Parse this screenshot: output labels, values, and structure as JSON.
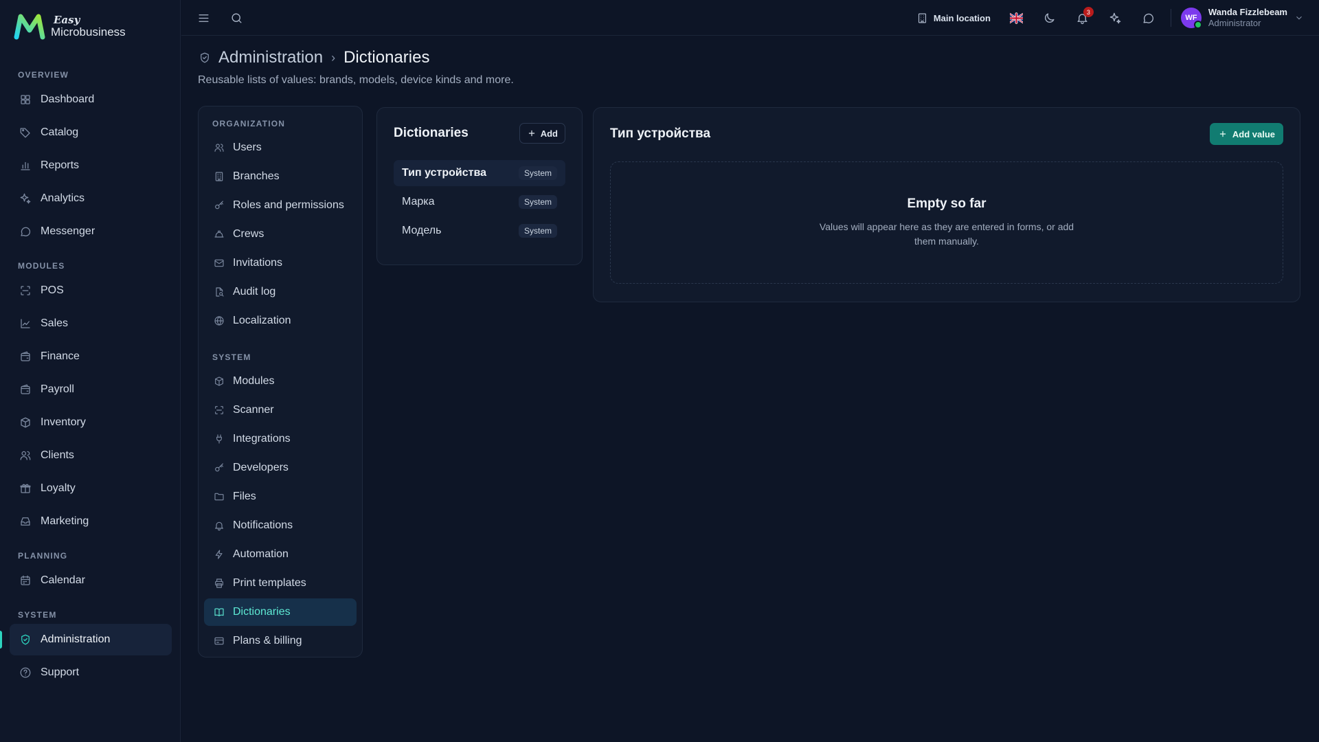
{
  "brand": {
    "easy": "Easy",
    "name": "Microbusiness"
  },
  "sidebar": {
    "sections": [
      {
        "title": "OVERVIEW",
        "items": [
          {
            "label": "Dashboard",
            "icon": "dashboard-icon"
          },
          {
            "label": "Catalog",
            "icon": "tag-icon"
          },
          {
            "label": "Reports",
            "icon": "bar-chart-icon"
          },
          {
            "label": "Analytics",
            "icon": "sparkles-icon"
          },
          {
            "label": "Messenger",
            "icon": "chat-icon"
          }
        ]
      },
      {
        "title": "MODULES",
        "items": [
          {
            "label": "POS",
            "icon": "scan-icon"
          },
          {
            "label": "Sales",
            "icon": "line-chart-icon"
          },
          {
            "label": "Finance",
            "icon": "wallet-icon"
          },
          {
            "label": "Payroll",
            "icon": "wallet-icon"
          },
          {
            "label": "Inventory",
            "icon": "box-icon"
          },
          {
            "label": "Clients",
            "icon": "users-icon"
          },
          {
            "label": "Loyalty",
            "icon": "gift-icon"
          },
          {
            "label": "Marketing",
            "icon": "inbox-icon"
          }
        ]
      },
      {
        "title": "PLANNING",
        "items": [
          {
            "label": "Calendar",
            "icon": "calendar-icon"
          }
        ]
      },
      {
        "title": "SYSTEM",
        "items": [
          {
            "label": "Administration",
            "icon": "shield-icon",
            "active": true
          },
          {
            "label": "Support",
            "icon": "help-icon"
          }
        ]
      }
    ]
  },
  "topbar": {
    "location": "Main location",
    "notifications_count": "3",
    "user": {
      "initials": "WF",
      "name": "Wanda Fizzlebeam",
      "role": "Administrator"
    }
  },
  "page": {
    "breadcrumb_parent": "Administration",
    "breadcrumb_sep": "›",
    "title": "Dictionaries",
    "description": "Reusable lists of values: brands, models, device kinds and more."
  },
  "submenu": {
    "sections": [
      {
        "title": "ORGANIZATION",
        "items": [
          {
            "label": "Users",
            "icon": "users-icon"
          },
          {
            "label": "Branches",
            "icon": "building-icon"
          },
          {
            "label": "Roles and permissions",
            "icon": "key-icon"
          },
          {
            "label": "Crews",
            "icon": "hard-hat-icon"
          },
          {
            "label": "Invitations",
            "icon": "mail-icon"
          },
          {
            "label": "Audit log",
            "icon": "file-search-icon"
          },
          {
            "label": "Localization",
            "icon": "globe-icon"
          }
        ]
      },
      {
        "title": "SYSTEM",
        "items": [
          {
            "label": "Modules",
            "icon": "box-icon"
          },
          {
            "label": "Scanner",
            "icon": "scan-icon"
          },
          {
            "label": "Integrations",
            "icon": "plug-icon"
          },
          {
            "label": "Developers",
            "icon": "key-icon"
          },
          {
            "label": "Files",
            "icon": "folder-icon"
          },
          {
            "label": "Notifications",
            "icon": "bell-icon"
          },
          {
            "label": "Automation",
            "icon": "zap-icon"
          },
          {
            "label": "Print templates",
            "icon": "printer-icon"
          },
          {
            "label": "Dictionaries",
            "icon": "book-icon",
            "active": true
          },
          {
            "label": "Plans & billing",
            "icon": "credit-card-icon"
          }
        ]
      }
    ]
  },
  "dictionaries": {
    "title": "Dictionaries",
    "add_label": "Add",
    "items": [
      {
        "name": "Тип устройства",
        "tag": "System",
        "active": true
      },
      {
        "name": "Марка",
        "tag": "System"
      },
      {
        "name": "Модель",
        "tag": "System"
      }
    ]
  },
  "detail": {
    "title": "Тип устройства",
    "add_value_label": "Add value",
    "empty_title": "Empty so far",
    "empty_text": "Values will appear here as they are entered in forms, or add them manually."
  },
  "colors": {
    "accent": "#2dd4bf",
    "primary_button": "#117c71",
    "background": "#0d1526",
    "avatar": "#7c3aed"
  }
}
